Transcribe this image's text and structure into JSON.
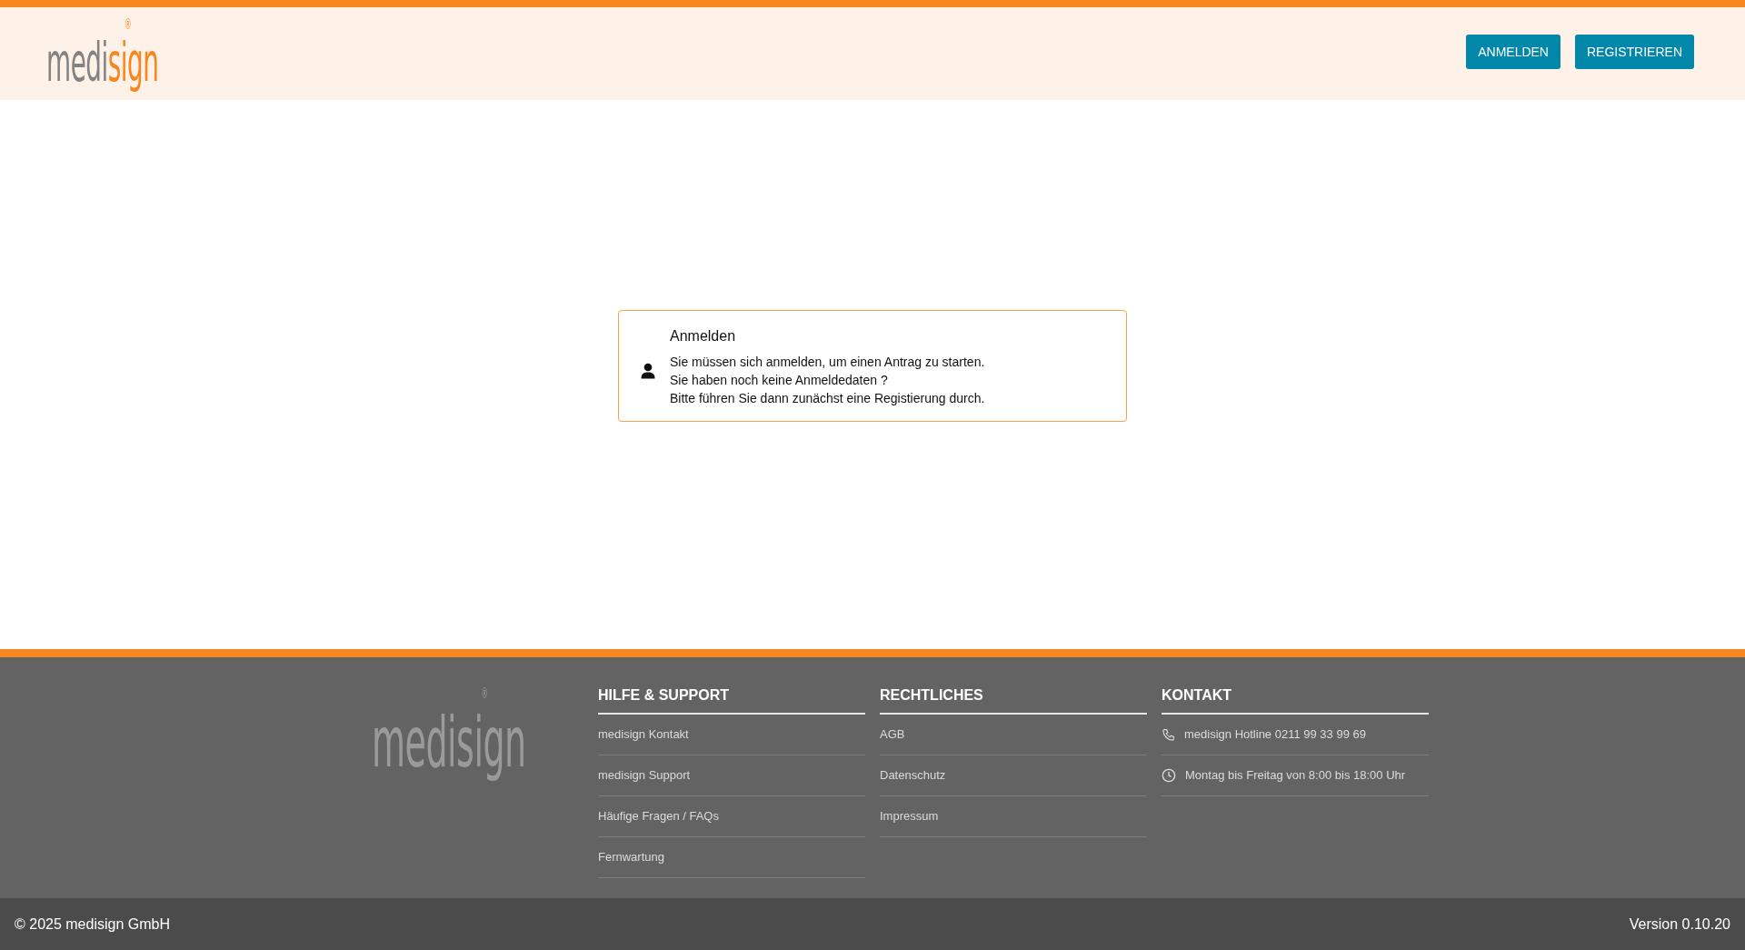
{
  "header": {
    "logo": {
      "part_1": "medi",
      "part_2": "sign",
      "mark": "®"
    },
    "buttons": [
      {
        "label": "ANMELDEN"
      },
      {
        "label": "REGISTRIEREN"
      }
    ]
  },
  "notice": {
    "title": "Anmelden",
    "lines": [
      "Sie müssen sich anmelden, um einen Antrag zu starten.",
      "Sie haben noch keine Anmeldedaten ?",
      "Bitte führen Sie dann zunächst eine Registierung durch."
    ]
  },
  "footer": {
    "logo": {
      "part_1": "medi",
      "part_2": "sign",
      "mark": "®"
    },
    "columns": [
      {
        "heading": "HILFE & SUPPORT",
        "items": [
          {
            "label": "medisign Kontakt"
          },
          {
            "label": "medisign Support"
          },
          {
            "label": "Häufige Fragen / FAQs"
          },
          {
            "label": "Fernwartung"
          }
        ]
      },
      {
        "heading": "RECHTLICHES",
        "items": [
          {
            "label": "AGB"
          },
          {
            "label": "Datenschutz"
          },
          {
            "label": "Impressum"
          }
        ]
      },
      {
        "heading": "KONTAKT",
        "items": [
          {
            "label": "medisign Hotline 0211 99 33 99 69",
            "kind": "phone"
          },
          {
            "label": "Montag bis Freitag von 8:00 bis 18:00 Uhr",
            "kind": "hours"
          }
        ]
      }
    ]
  },
  "bottom_bar": {
    "copyright": "© 2025 medisign GmbH",
    "version": "Version 0.10.20"
  }
}
